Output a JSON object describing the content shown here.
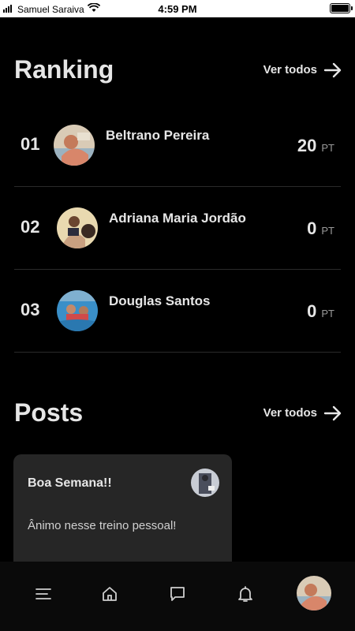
{
  "status_bar": {
    "carrier": "Samuel Saraiva",
    "time": "4:59 PM"
  },
  "ranking": {
    "title": "Ranking",
    "see_all": "Ver todos",
    "items": [
      {
        "position": "01",
        "name": "Beltrano Pereira",
        "score": "20",
        "unit": "PT"
      },
      {
        "position": "02",
        "name": "Adriana Maria Jordão",
        "score": "0",
        "unit": "PT"
      },
      {
        "position": "03",
        "name": "Douglas Santos",
        "score": "0",
        "unit": "PT"
      }
    ]
  },
  "posts": {
    "title": "Posts",
    "see_all": "Ver todos",
    "items": [
      {
        "title": "Boa Semana!!",
        "body": "Ânimo nesse treino pessoal!"
      }
    ]
  },
  "bottom_nav": {
    "items": [
      "menu-icon",
      "home-icon",
      "chat-icon",
      "bell-icon",
      "profile-avatar"
    ]
  },
  "colors": {
    "background": "#000000",
    "card": "#262626",
    "text": "#e6e6e6",
    "muted": "#9a9a9a"
  }
}
